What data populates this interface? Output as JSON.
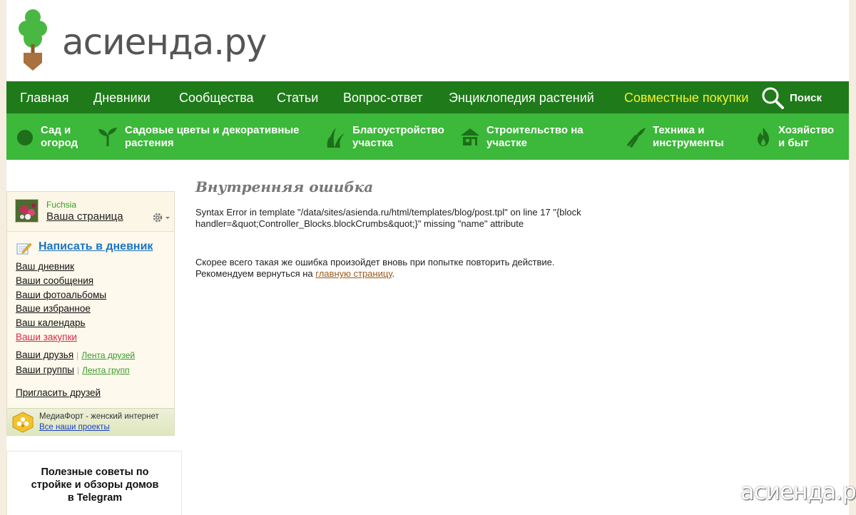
{
  "logo": {
    "text": "асиенда.ру"
  },
  "nav_main": {
    "items": [
      {
        "label": "Главная"
      },
      {
        "label": "Дневники"
      },
      {
        "label": "Сообщества"
      },
      {
        "label": "Статьи"
      },
      {
        "label": "Вопрос-ответ"
      },
      {
        "label": "Энциклопедия растений"
      },
      {
        "label": "Совместные покупки"
      }
    ],
    "search_label": "Поиск",
    "highlight_color": "#f2f230"
  },
  "nav_sub": {
    "items": [
      {
        "line1": "Сад и",
        "line2": "огород",
        "icon": "tomato-icon"
      },
      {
        "line1": "Садовые цветы и декоративные",
        "line2": "растения",
        "icon": "sprout-icon"
      },
      {
        "line1": "Благоустройство",
        "line2": "участка",
        "icon": "grass-icon"
      },
      {
        "line1": "Строительство на",
        "line2": "участке",
        "icon": "house-icon"
      },
      {
        "line1": "Техника и",
        "line2": "инструменты",
        "icon": "pruner-icon"
      },
      {
        "line1": "Хозяйство",
        "line2": "и быт",
        "icon": "fire-icon"
      }
    ]
  },
  "sidebar": {
    "username": "Fuchsia",
    "my_page": "Ваша страница",
    "write_link": "Написать в дневник",
    "links": [
      "Ваш дневник",
      "Ваши сообщения",
      "Ваши фотоальбомы",
      "Ваше избранное",
      "Ваш календарь",
      "Ваши закупки"
    ],
    "friends": {
      "main": "Ваши друзья",
      "sep": "|",
      "feed": "Лента друзей"
    },
    "groups": {
      "main": "Ваши группы",
      "sep": "|",
      "feed": "Лента групп"
    },
    "invite": "Пригласить друзей",
    "mediafort": {
      "title": "МедиаФорт - женский интернет",
      "link": "Все наши проекты"
    }
  },
  "telegram_box": {
    "line1": "Полезные советы по",
    "line2": "стройке и обзоры домов",
    "line3": "в Telegram"
  },
  "error": {
    "title": "Внутренняя ошибка",
    "message": "Syntax Error in template \"/data/sites/asienda.ru/html/templates/blog/post.tpl\" on line 17 \"{block handler=&quot;Controller_Blocks.blockCrumbs&quot;}\" missing \"name\" attribute",
    "hint_line1": "Скорее всего такая же ошибка произойдет вновь при попытке повторить действие.",
    "hint_prefix": "Рекомендуем вернуться на ",
    "hint_link": "главную страницу",
    "hint_suffix": "."
  },
  "watermark": {
    "text": "асиенда.ру"
  },
  "colors": {
    "nav_main_bg": "#1f7a1a",
    "nav_sub_bg": "#3cb83a",
    "link_blue": "#1a73c4",
    "link_red": "#e0264a",
    "link_green": "#3a9a2a"
  }
}
